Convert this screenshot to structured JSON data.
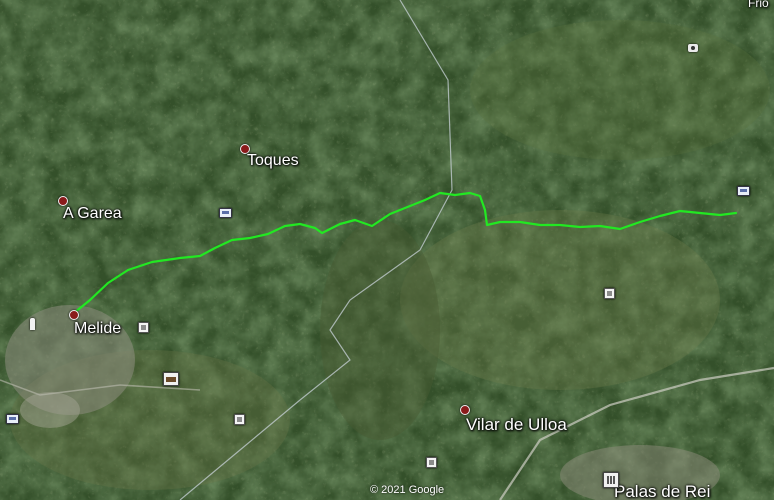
{
  "map": {
    "copyright": "© 2021 Google",
    "places": [
      {
        "id": "toques",
        "name": "Toques"
      },
      {
        "id": "a-garea",
        "name": "A Garea"
      },
      {
        "id": "melide",
        "name": "Melide"
      },
      {
        "id": "vilar-de-ulloa",
        "name": "Vilar de Ulloa"
      },
      {
        "id": "palas-de-rei",
        "name": "Palas de Rei"
      },
      {
        "id": "frio",
        "name": "Frio"
      }
    ],
    "route_color": "#22e822",
    "pin_color": "#8a1b1b"
  }
}
